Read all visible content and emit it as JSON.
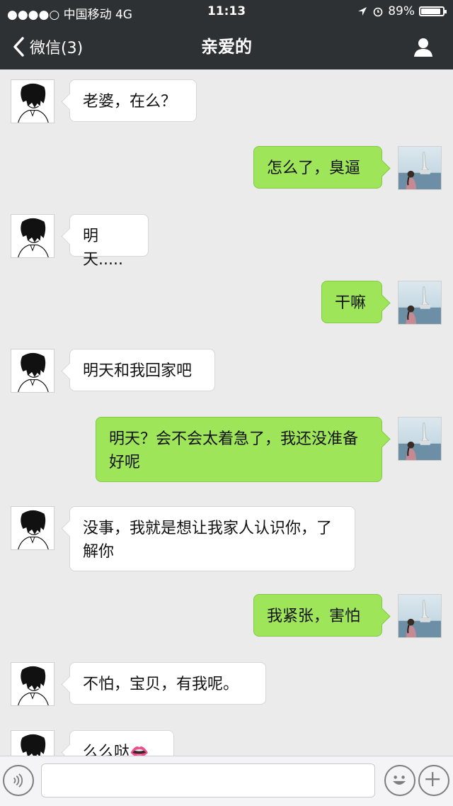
{
  "status_bar": {
    "carrier": "●●●●○ 中国移动   4G",
    "time": "11:13",
    "battery": "89%",
    "battery_level": 0.89
  },
  "nav": {
    "back_label": "微信(3)",
    "title": "亲爱的",
    "profile_icon": "person-icon"
  },
  "messages": [
    {
      "side": "in",
      "text": "老婆，在么？"
    },
    {
      "side": "out",
      "text": "怎么了，臭逼"
    },
    {
      "side": "in",
      "text": "明天....."
    },
    {
      "side": "out",
      "text": "干嘛"
    },
    {
      "side": "in",
      "text": "明天和我回家吧"
    },
    {
      "side": "out",
      "text": "明天？会不会太着急了，我还没准备好呢"
    },
    {
      "side": "in",
      "text": "没事，我就是想让我家人认识你，了解你"
    },
    {
      "side": "out",
      "text": "我紧张，害怕"
    },
    {
      "side": "in",
      "text": "不怕，宝贝，有我呢。"
    },
    {
      "side": "in",
      "text": "么么哒👄"
    }
  ],
  "input_bar": {
    "voice_icon": "voice-icon",
    "input_value": "",
    "emoji_icon": "emoji-icon",
    "add_icon": "add-icon"
  },
  "colors": {
    "header": "#2e3133",
    "outgoing_bubble": "#9fe55a",
    "incoming_bubble": "#ffffff",
    "chat_background": "#ebebeb"
  }
}
